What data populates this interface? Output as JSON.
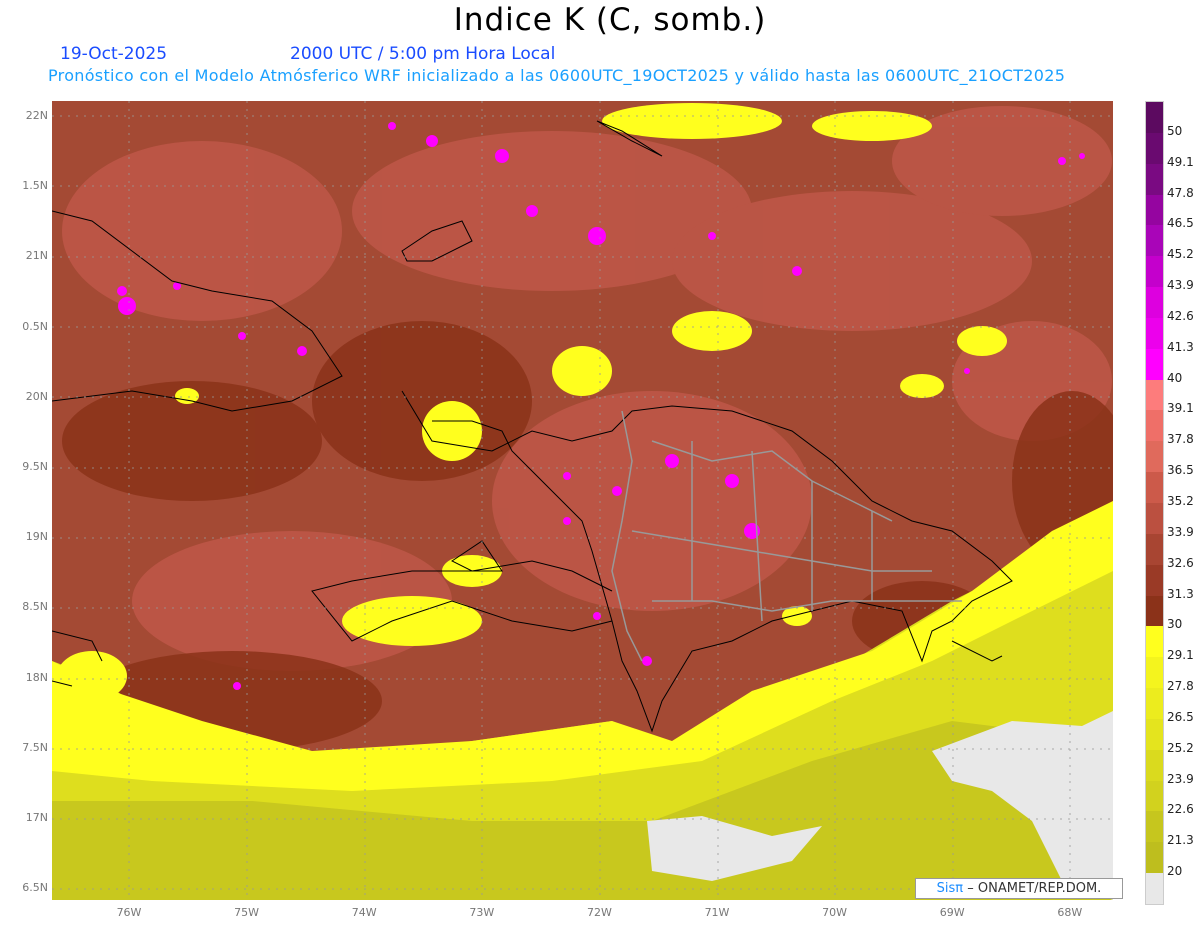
{
  "header": {
    "title": "Indice K (C, somb.)",
    "date": "19-Oct-2025",
    "time": "2000 UTC / 5:00 pm Hora Local",
    "subtitle": "Pronóstico con el Modelo Atmósferico WRF inicializado a las 0600UTC_19OCT2025 y válido hasta las  0600UTC_21OCT2025"
  },
  "axes": {
    "lat_labels": [
      "22N",
      "1.5N",
      "21N",
      "0.5N",
      "20N",
      "9.5N",
      "19N",
      "8.5N",
      "18N",
      "7.5N",
      "17N",
      "6.5N"
    ],
    "lon_labels": [
      "76W",
      "75W",
      "74W",
      "73W",
      "72W",
      "71W",
      "70W",
      "69W",
      "68W"
    ]
  },
  "legend": {
    "labels": [
      "50",
      "49.1",
      "47.8",
      "46.5",
      "45.2",
      "43.9",
      "42.6",
      "41.3",
      "40",
      "39.1",
      "37.8",
      "36.5",
      "35.2",
      "33.9",
      "32.6",
      "31.3",
      "30",
      "29.1",
      "27.8",
      "26.5",
      "25.2",
      "23.9",
      "22.6",
      "21.3",
      "20"
    ],
    "colors": [
      "#5c0a60",
      "#6a0a70",
      "#7a0a82",
      "#9505a0",
      "#a905b8",
      "#c400cc",
      "#dd00df",
      "#ec00ec",
      "#ff00ff",
      "#fd7c7c",
      "#ef6f68",
      "#e06a5c",
      "#cc5a4a",
      "#bb5040",
      "#a84532",
      "#9a3a26",
      "#8b3219",
      "#ffff1e",
      "#f4f41e",
      "#ecec1e",
      "#e4e41e",
      "#dada1e",
      "#d2d21e",
      "#c6c61e",
      "#bebe1e",
      "#e8e8e8"
    ]
  },
  "credit": {
    "brand": "Sisπ",
    "org": "– ONAMET/REP.DOM."
  }
}
